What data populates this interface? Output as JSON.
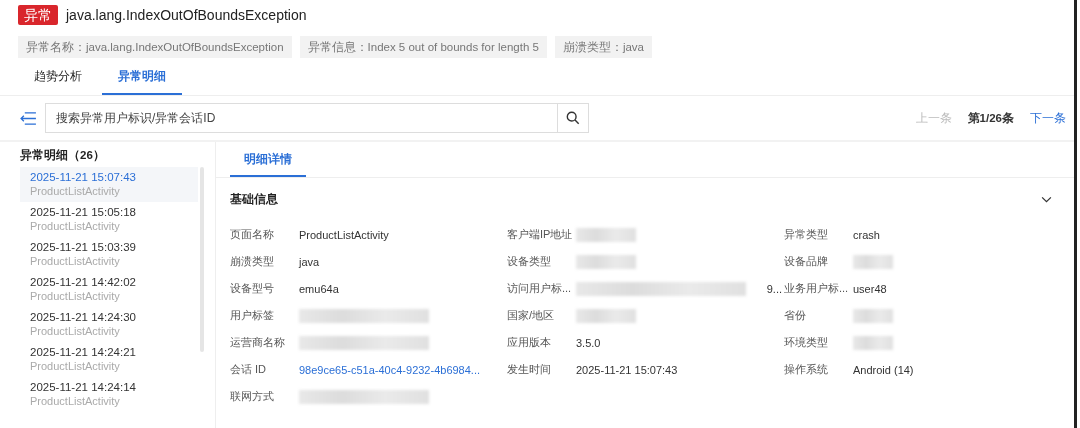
{
  "header": {
    "badge": "异常",
    "title": "java.lang.IndexOutOfBoundsException"
  },
  "tags": [
    "异常名称：java.lang.IndexOutOfBoundsException",
    "异常信息：Index 5 out of bounds for length 5",
    "崩溃类型：java"
  ],
  "tabs": [
    {
      "label": "趋势分析",
      "selected": false
    },
    {
      "label": "异常明细",
      "selected": true
    }
  ],
  "search": {
    "placeholder": "搜索异常用户标识/异常会话ID"
  },
  "pager": {
    "prev": {
      "label": "上一条",
      "disabled": true
    },
    "position": "第1/26条",
    "next": {
      "label": "下一条",
      "disabled": false
    }
  },
  "list": {
    "title": "异常明细（26）",
    "items": [
      {
        "time": "2025-11-21 15:07:43",
        "page": "ProductListActivity",
        "selected": true
      },
      {
        "time": "2025-11-21 15:05:18",
        "page": "ProductListActivity",
        "selected": false
      },
      {
        "time": "2025-11-21 15:03:39",
        "page": "ProductListActivity",
        "selected": false
      },
      {
        "time": "2025-11-21 14:42:02",
        "page": "ProductListActivity",
        "selected": false
      },
      {
        "time": "2025-11-21 14:24:30",
        "page": "ProductListActivity",
        "selected": false
      },
      {
        "time": "2025-11-21 14:24:21",
        "page": "ProductListActivity",
        "selected": false
      },
      {
        "time": "2025-11-21 14:24:14",
        "page": "ProductListActivity",
        "selected": false
      }
    ]
  },
  "detail_tabs": [
    {
      "label": "明细详情",
      "selected": true
    }
  ],
  "section": {
    "title": "基础信息",
    "expanded": true
  },
  "fields": [
    {
      "label": "页面名称",
      "value": "ProductListActivity",
      "kind": "text"
    },
    {
      "label": "客户端IP地址",
      "kind": "redacted"
    },
    {
      "label": "异常类型",
      "value": "crash",
      "kind": "text"
    },
    {
      "label": "崩溃类型",
      "value": "java",
      "kind": "text"
    },
    {
      "label": "设备类型",
      "kind": "redacted"
    },
    {
      "label": "设备品牌",
      "kind": "redacted"
    },
    {
      "label": "设备型号",
      "value": "emu64a",
      "kind": "text"
    },
    {
      "label": "访问用户标...",
      "value": "9...",
      "kind": "redacted"
    },
    {
      "label": "业务用户标...",
      "value": "user48",
      "kind": "text"
    },
    {
      "label": "用户标签",
      "kind": "redacted"
    },
    {
      "label": "国家/地区",
      "kind": "redacted"
    },
    {
      "label": "省份",
      "kind": "redacted"
    },
    {
      "label": "运营商名称",
      "kind": "redacted"
    },
    {
      "label": "应用版本",
      "value": "3.5.0",
      "kind": "text"
    },
    {
      "label": "环境类型",
      "kind": "redacted"
    },
    {
      "label": "会话 ID",
      "value": "98e9ce65-c51a-40c4-9232-4b6984...",
      "kind": "link"
    },
    {
      "label": "发生时间",
      "value": "2025-11-21 15:07:43",
      "kind": "text"
    },
    {
      "label": "操作系统",
      "value": "Android (14)",
      "kind": "text"
    },
    {
      "label": "联网方式",
      "kind": "redacted"
    }
  ]
}
